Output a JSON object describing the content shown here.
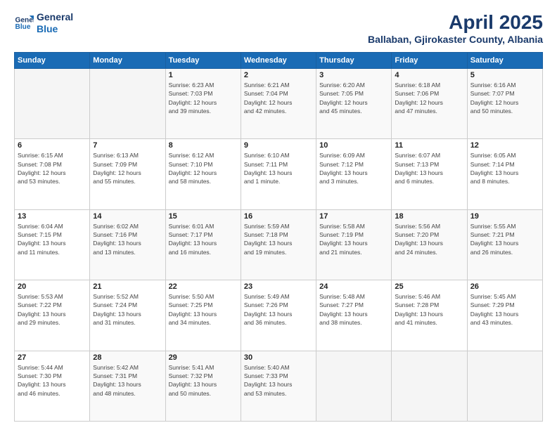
{
  "logo": {
    "line1": "General",
    "line2": "Blue"
  },
  "title": "April 2025",
  "subtitle": "Ballaban, Gjirokaster County, Albania",
  "weekdays": [
    "Sunday",
    "Monday",
    "Tuesday",
    "Wednesday",
    "Thursday",
    "Friday",
    "Saturday"
  ],
  "weeks": [
    [
      {
        "day": "",
        "info": ""
      },
      {
        "day": "",
        "info": ""
      },
      {
        "day": "1",
        "info": "Sunrise: 6:23 AM\nSunset: 7:03 PM\nDaylight: 12 hours\nand 39 minutes."
      },
      {
        "day": "2",
        "info": "Sunrise: 6:21 AM\nSunset: 7:04 PM\nDaylight: 12 hours\nand 42 minutes."
      },
      {
        "day": "3",
        "info": "Sunrise: 6:20 AM\nSunset: 7:05 PM\nDaylight: 12 hours\nand 45 minutes."
      },
      {
        "day": "4",
        "info": "Sunrise: 6:18 AM\nSunset: 7:06 PM\nDaylight: 12 hours\nand 47 minutes."
      },
      {
        "day": "5",
        "info": "Sunrise: 6:16 AM\nSunset: 7:07 PM\nDaylight: 12 hours\nand 50 minutes."
      }
    ],
    [
      {
        "day": "6",
        "info": "Sunrise: 6:15 AM\nSunset: 7:08 PM\nDaylight: 12 hours\nand 53 minutes."
      },
      {
        "day": "7",
        "info": "Sunrise: 6:13 AM\nSunset: 7:09 PM\nDaylight: 12 hours\nand 55 minutes."
      },
      {
        "day": "8",
        "info": "Sunrise: 6:12 AM\nSunset: 7:10 PM\nDaylight: 12 hours\nand 58 minutes."
      },
      {
        "day": "9",
        "info": "Sunrise: 6:10 AM\nSunset: 7:11 PM\nDaylight: 13 hours\nand 1 minute."
      },
      {
        "day": "10",
        "info": "Sunrise: 6:09 AM\nSunset: 7:12 PM\nDaylight: 13 hours\nand 3 minutes."
      },
      {
        "day": "11",
        "info": "Sunrise: 6:07 AM\nSunset: 7:13 PM\nDaylight: 13 hours\nand 6 minutes."
      },
      {
        "day": "12",
        "info": "Sunrise: 6:05 AM\nSunset: 7:14 PM\nDaylight: 13 hours\nand 8 minutes."
      }
    ],
    [
      {
        "day": "13",
        "info": "Sunrise: 6:04 AM\nSunset: 7:15 PM\nDaylight: 13 hours\nand 11 minutes."
      },
      {
        "day": "14",
        "info": "Sunrise: 6:02 AM\nSunset: 7:16 PM\nDaylight: 13 hours\nand 13 minutes."
      },
      {
        "day": "15",
        "info": "Sunrise: 6:01 AM\nSunset: 7:17 PM\nDaylight: 13 hours\nand 16 minutes."
      },
      {
        "day": "16",
        "info": "Sunrise: 5:59 AM\nSunset: 7:18 PM\nDaylight: 13 hours\nand 19 minutes."
      },
      {
        "day": "17",
        "info": "Sunrise: 5:58 AM\nSunset: 7:19 PM\nDaylight: 13 hours\nand 21 minutes."
      },
      {
        "day": "18",
        "info": "Sunrise: 5:56 AM\nSunset: 7:20 PM\nDaylight: 13 hours\nand 24 minutes."
      },
      {
        "day": "19",
        "info": "Sunrise: 5:55 AM\nSunset: 7:21 PM\nDaylight: 13 hours\nand 26 minutes."
      }
    ],
    [
      {
        "day": "20",
        "info": "Sunrise: 5:53 AM\nSunset: 7:22 PM\nDaylight: 13 hours\nand 29 minutes."
      },
      {
        "day": "21",
        "info": "Sunrise: 5:52 AM\nSunset: 7:24 PM\nDaylight: 13 hours\nand 31 minutes."
      },
      {
        "day": "22",
        "info": "Sunrise: 5:50 AM\nSunset: 7:25 PM\nDaylight: 13 hours\nand 34 minutes."
      },
      {
        "day": "23",
        "info": "Sunrise: 5:49 AM\nSunset: 7:26 PM\nDaylight: 13 hours\nand 36 minutes."
      },
      {
        "day": "24",
        "info": "Sunrise: 5:48 AM\nSunset: 7:27 PM\nDaylight: 13 hours\nand 38 minutes."
      },
      {
        "day": "25",
        "info": "Sunrise: 5:46 AM\nSunset: 7:28 PM\nDaylight: 13 hours\nand 41 minutes."
      },
      {
        "day": "26",
        "info": "Sunrise: 5:45 AM\nSunset: 7:29 PM\nDaylight: 13 hours\nand 43 minutes."
      }
    ],
    [
      {
        "day": "27",
        "info": "Sunrise: 5:44 AM\nSunset: 7:30 PM\nDaylight: 13 hours\nand 46 minutes."
      },
      {
        "day": "28",
        "info": "Sunrise: 5:42 AM\nSunset: 7:31 PM\nDaylight: 13 hours\nand 48 minutes."
      },
      {
        "day": "29",
        "info": "Sunrise: 5:41 AM\nSunset: 7:32 PM\nDaylight: 13 hours\nand 50 minutes."
      },
      {
        "day": "30",
        "info": "Sunrise: 5:40 AM\nSunset: 7:33 PM\nDaylight: 13 hours\nand 53 minutes."
      },
      {
        "day": "",
        "info": ""
      },
      {
        "day": "",
        "info": ""
      },
      {
        "day": "",
        "info": ""
      }
    ]
  ]
}
